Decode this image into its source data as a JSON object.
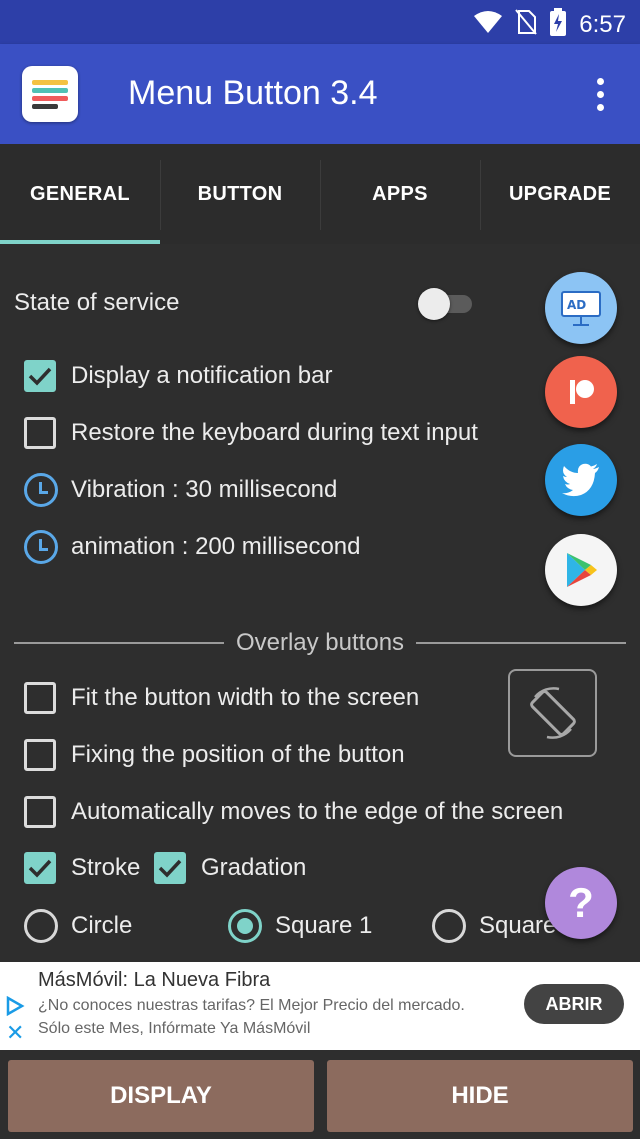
{
  "status_bar": {
    "time": "6:57"
  },
  "app_bar": {
    "title": "Menu Button 3.4"
  },
  "tabs": [
    {
      "label": "GENERAL",
      "active": true
    },
    {
      "label": "BUTTON",
      "active": false
    },
    {
      "label": "APPS",
      "active": false
    },
    {
      "label": "UPGRADE",
      "active": false
    }
  ],
  "general": {
    "state_of_service": {
      "label": "State of service",
      "enabled": false
    },
    "notification_bar": {
      "label": "Display a notification bar",
      "checked": true
    },
    "restore_keyboard": {
      "label": "Restore the keyboard during text input",
      "checked": false
    },
    "vibration": {
      "label": "Vibration : 30 millisecond"
    },
    "animation": {
      "label": "animation : 200 millisecond"
    }
  },
  "overlay": {
    "title": "Overlay buttons",
    "fit_width": {
      "label": "Fit the button width to the screen",
      "checked": false
    },
    "fix_position": {
      "label": "Fixing the position of the button",
      "checked": false
    },
    "auto_edge": {
      "label": "Automatically moves to the edge of the screen",
      "checked": false
    },
    "stroke": {
      "label": "Stroke",
      "checked": true
    },
    "gradation": {
      "label": "Gradation",
      "checked": true
    },
    "shapes": [
      {
        "label": "Circle",
        "selected": false
      },
      {
        "label": "Square 1",
        "selected": true
      },
      {
        "label": "Square",
        "selected": false
      }
    ]
  },
  "side_buttons": {
    "ad_icon_text": "AD",
    "help_text": "?"
  },
  "ad": {
    "title": "MásMóvil: La Nueva Fibra",
    "line1": "¿No conoces nuestras tarifas? El Mejor Precio del mercado.",
    "line2": "Sólo este Mes, Infórmate Ya MásMóvil",
    "button": "ABRIR"
  },
  "bottom": {
    "display": "DISPLAY",
    "hide": "HIDE"
  },
  "colors": {
    "status_bar": "#2d3fa8",
    "app_bar": "#3a50c4",
    "accent": "#7fd3c9",
    "bottom_button": "#8c6b5e"
  }
}
